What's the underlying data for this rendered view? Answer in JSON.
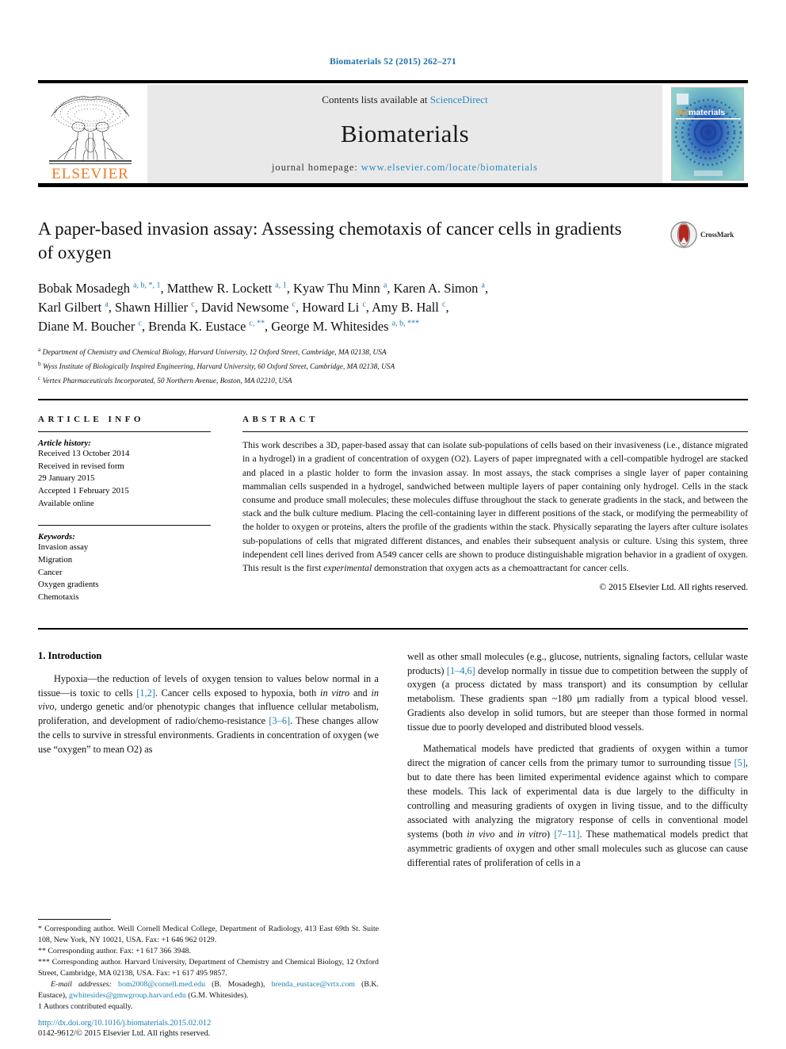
{
  "running_head": "Biomaterials 52 (2015) 262–271",
  "masthead": {
    "publisher_name": "ELSEVIER",
    "contents_prefix": "Contents lists available at ",
    "contents_link": "ScienceDirect",
    "journal_title": "Biomaterials",
    "homepage_prefix": "journal homepage: ",
    "homepage_url": "www.elsevier.com/locate/biomaterials",
    "cover_label": "Biomaterials"
  },
  "article": {
    "title": "A paper-based invasion assay: Assessing chemotaxis of cancer cells in gradients of oxygen",
    "crossmark_label": "CrossMark",
    "authors_lines": [
      "Bobak Mosadegh a, b, *, 1, Matthew R. Lockett a, 1, Kyaw Thu Minn a, Karen A. Simon a,",
      "Karl Gilbert a, Shawn Hillier c, David Newsome c, Howard Li c, Amy B. Hall c,",
      "Diane M. Boucher c, Brenda K. Eustace c, **, George M. Whitesides a, b, ***"
    ],
    "affiliations": [
      "a Department of Chemistry and Chemical Biology, Harvard University, 12 Oxford Street, Cambridge, MA 02138, USA",
      "b Wyss Institute of Biologically Inspired Engineering, Harvard University, 60 Oxford Street, Cambridge, MA 02138, USA",
      "c Vertex Pharmaceuticals Incorporated, 50 Northern Avenue, Boston, MA 02210, USA"
    ]
  },
  "article_info": {
    "heading": "ARTICLE INFO",
    "history_label": "Article history:",
    "history": [
      "Received 13 October 2014",
      "Received in revised form",
      "29 January 2015",
      "Accepted 1 February 2015",
      "Available online"
    ],
    "keywords_label": "Keywords:",
    "keywords": [
      "Invasion assay",
      "Migration",
      "Cancer",
      "Oxygen gradients",
      "Chemotaxis"
    ]
  },
  "abstract": {
    "heading": "ABSTRACT",
    "text_part1": "This work describes a 3D, paper-based assay that can isolate sub-populations of cells based on their invasiveness (i.e., distance migrated in a hydrogel) in a gradient of concentration of oxygen (O2). Layers of paper impregnated with a cell-compatible hydrogel are stacked and placed in a plastic holder to form the invasion assay. In most assays, the stack comprises a single layer of paper containing mammalian cells suspended in a hydrogel, sandwiched between multiple layers of paper containing only hydrogel. Cells in the stack consume and produce small molecules; these molecules diffuse throughout the stack to generate gradients in the stack, and between the stack and the bulk culture medium. Placing the cell-containing layer in different positions of the stack, or modifying the permeability of the holder to oxygen or proteins, alters the profile of the gradients within the stack. Physically separating the layers after culture isolates sub-populations of cells that migrated different distances, and enables their subsequent analysis or culture. Using this system, three independent cell lines derived from A549 cancer cells are shown to produce distinguishable migration behavior in a gradient of oxygen. This result is the first ",
    "emphasis": "experimental",
    "text_part2": " demonstration that oxygen acts as a chemoattractant for cancer cells.",
    "copyright": "© 2015 Elsevier Ltd. All rights reserved."
  },
  "body": {
    "section_number_title": "1. Introduction",
    "left_paragraph_1_a": "Hypoxia—the reduction of levels of oxygen tension to values below normal in a tissue—is toxic to cells ",
    "left_ref_1": "[1,2]",
    "left_paragraph_1_b": ". Cancer cells exposed to hypoxia, both ",
    "left_italic_1": "in vitro",
    "left_paragraph_1_c": " and ",
    "left_italic_2": "in vivo",
    "left_paragraph_1_d": ", undergo genetic and/or phenotypic changes that influence cellular metabolism, proliferation, and development of radio/chemo-resistance ",
    "left_ref_2": "[3–6]",
    "left_paragraph_1_e": ". These changes allow the cells to survive in stressful environments. Gradients in concentration of oxygen (we use “oxygen” to mean O2) as",
    "right_paragraph_1_a": "well as other small molecules (e.g., glucose, nutrients, signaling factors, cellular waste products) ",
    "right_ref_1": "[1–4,6]",
    "right_paragraph_1_b": " develop normally in tissue due to competition between the supply of oxygen (a process dictated by mass transport) and its consumption by cellular metabolism. These gradients span ~180 μm radially from a typical blood vessel. Gradients also develop in solid tumors, but are steeper than those formed in normal tissue due to poorly developed and distributed blood vessels.",
    "right_paragraph_2_a": "Mathematical models have predicted that gradients of oxygen within a tumor direct the migration of cancer cells from the primary tumor to surrounding tissue ",
    "right_ref_2": "[5]",
    "right_paragraph_2_b": ", but to date there has been limited experimental evidence against which to compare these models. This lack of experimental data is due largely to the difficulty in controlling and measuring gradients of oxygen in living tissue, and to the difficulty associated with analyzing the migratory response of cells in conventional model systems (both ",
    "right_italic_1": "in vivo",
    "right_paragraph_2_c": " and ",
    "right_italic_2": "in vitro",
    "right_paragraph_2_d": ") ",
    "right_ref_3": "[7–11]",
    "right_paragraph_2_e": ". These mathematical models predict that asymmetric gradients of oxygen and other small molecules such as glucose can cause differential rates of proliferation of cells in a"
  },
  "footnotes": {
    "fn1": "* Corresponding author. Weill Cornell Medical College, Department of Radiology, 413 East 69th St. Suite 108, New York, NY 10021, USA. Fax: +1 646 962 0129.",
    "fn2": "** Corresponding author. Fax: +1 617 366 3948.",
    "fn3": "*** Corresponding author. Harvard University, Department of Chemistry and Chemical Biology, 12 Oxford Street, Cambridge, MA 02138, USA. Fax: +1 617 495 9857.",
    "email_label": "E-mail addresses:",
    "email_1": "bom2008@cornell.med.edu",
    "email_1_owner": " (B. Mosadegh), ",
    "email_2": "brenda_eustace@vrtx.com",
    "email_2_owner": " (B.K. Eustace), ",
    "email_3": "gwhitesides@gmwgroup.harvard.edu",
    "email_3_owner": " (G.M. Whitesides).",
    "fn4": "1 Authors contributed equally."
  },
  "footer": {
    "doi": "http://dx.doi.org/10.1016/j.biomaterials.2015.02.012",
    "issn_copyright": "0142-9612/© 2015 Elsevier Ltd. All rights reserved."
  },
  "colors": {
    "link_blue": "#1f7fb5",
    "elsevier_orange": "#ee7a23",
    "masthead_grey": "#e9e9e9"
  }
}
